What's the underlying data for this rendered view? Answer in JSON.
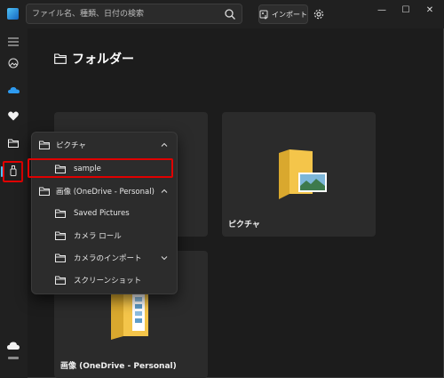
{
  "search": {
    "placeholder": "ファイル名、種類、日付の検索"
  },
  "toolbar": {
    "import_label": "インポート"
  },
  "window": {
    "minimize": "—",
    "maximize": "☐",
    "close": "✕"
  },
  "nav": {
    "items": [
      "menu-icon",
      "photos-icon",
      "onedrive-icon",
      "favorites-icon",
      "folders-icon",
      "device-icon",
      "cloud-icon"
    ]
  },
  "page": {
    "title": "フォルダー"
  },
  "cards": [
    {
      "label": "ピクチャ"
    },
    {
      "label": "画像 (OneDrive - Personal)"
    }
  ],
  "flyout": {
    "items": [
      {
        "label": "ピクチャ",
        "chevron": "up"
      },
      {
        "label": "sample"
      },
      {
        "label": "画像 (OneDrive - Personal)",
        "chevron": "up"
      },
      {
        "label": "Saved Pictures"
      },
      {
        "label": "カメラ ロール"
      },
      {
        "label": "カメラのインポート",
        "chevron": "down"
      },
      {
        "label": "スクリーンショット"
      }
    ]
  },
  "colors": {
    "accent": "#4cc2ff",
    "highlight": "#e00000",
    "background": "#1c1c1c",
    "folder": "#f4c54a"
  }
}
